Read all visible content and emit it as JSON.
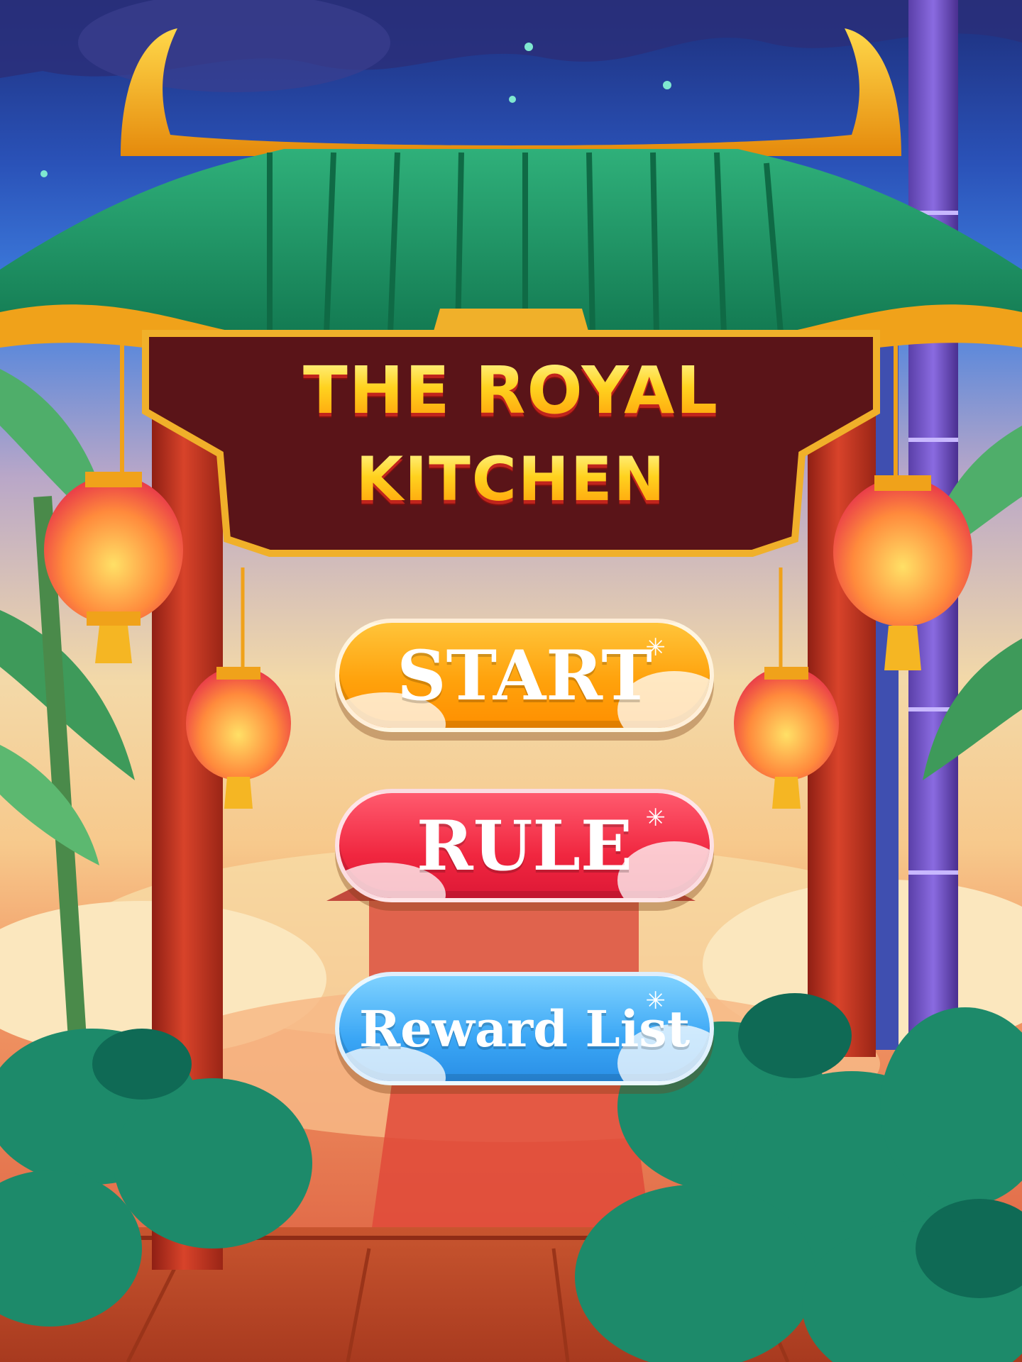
{
  "game": {
    "title_line1": "THE ROYAL",
    "title_line2": "KITCHEN"
  },
  "menu": {
    "start_label": "START",
    "rule_label": "RULE",
    "reward_label": "Reward List"
  },
  "colors": {
    "sky_top": "#1d2e7a",
    "sky_bottom": "#3f7fe0",
    "roof_green": "#1f9a6a",
    "roof_gold": "#f5a623",
    "sign_maroon": "#5a1418",
    "pillar_red": "#c8321e",
    "button_start": "#ffa20c",
    "button_rule": "#f0263f",
    "button_reward": "#3aa6f5"
  },
  "icons": [
    "lantern-icon",
    "sparkle-icon",
    "bamboo",
    "pagoda-roof"
  ]
}
